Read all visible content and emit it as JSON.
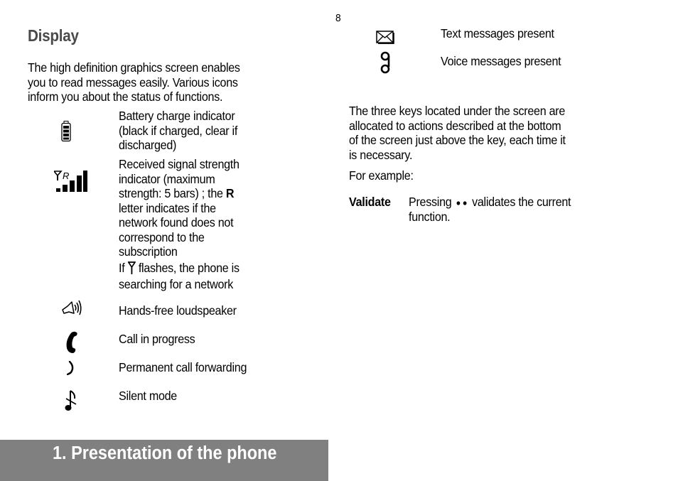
{
  "page": {
    "number": "8",
    "section_heading": "Display",
    "intro_lines": [
      "The high definition graphics screen enables",
      "you to read messages easily. Various icons",
      "inform you about the status of functions."
    ],
    "icon_table": [
      {
        "icon": "battery-icon",
        "lines": [
          "Battery charge indicator",
          "(black if charged, clear if",
          "discharged)"
        ]
      },
      {
        "icon": "signal-strength-icon",
        "lines": [
          "Received signal strength",
          "indicator (maximum"
        ],
        "line3_prefix": "strength: 5 bars) ; the ",
        "line3_bold": "R",
        "lines_after": [
          "letter indicates if the",
          "network found does not",
          "correspond to the",
          "subscription"
        ],
        "note_prefix": "If ",
        "note_icon": "antenna-icon",
        "note_suffix": " flashes, the phone is",
        "note_line2": "searching for a network"
      },
      {
        "icon": "loudspeaker-icon",
        "lines": [
          "Hands-free loudspeaker"
        ]
      },
      {
        "icon": "handset-icon",
        "lines": [
          "Call in progress"
        ]
      },
      {
        "icon": "call-forwarding-icon",
        "lines": [
          "Permanent call forwarding"
        ]
      },
      {
        "icon": "silent-mode-icon",
        "lines": [
          "Silent mode"
        ]
      },
      {
        "icon": "envelope-icon",
        "lines": [
          "Text messages present"
        ]
      },
      {
        "icon": "voicemail-icon",
        "lines": [
          "Voice messages present"
        ]
      }
    ],
    "keys_paragraph": [
      "The three keys located under the screen are",
      "allocated to actions described at the bottom",
      "of the screen just above the key, each time it",
      "is necessary."
    ],
    "example_label": "For example:",
    "example": {
      "term": "Validate",
      "desc_prefix": "Pressing ",
      "desc_icon": "two-dots-key-icon",
      "desc_suffix": " validates the current",
      "desc_line2": "function."
    },
    "footer": {
      "chapter_title": "1. Presentation of the phone",
      "bar_color": "#808080",
      "text_color": "#ffffff"
    }
  }
}
